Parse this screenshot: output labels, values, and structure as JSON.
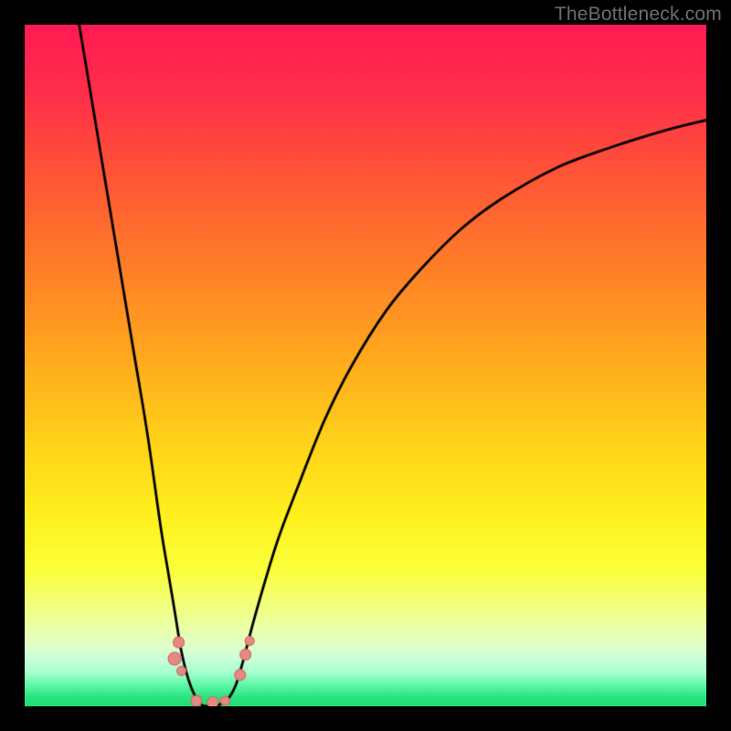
{
  "watermark": "TheBottleneck.com",
  "chart_data": {
    "type": "line",
    "title": "",
    "xlabel": "",
    "ylabel": "",
    "xlim": [
      0,
      100
    ],
    "ylim": [
      0,
      100
    ],
    "grid": false,
    "series": [
      {
        "name": "curve",
        "color": "#000000",
        "x": [
          8,
          10,
          12,
          14,
          16,
          18,
          20,
          21,
          22,
          23,
          24,
          25,
          26,
          27,
          28,
          29,
          30,
          31,
          32,
          34,
          37,
          40,
          44,
          48,
          53,
          58,
          64,
          70,
          78,
          86,
          94,
          100
        ],
        "y": [
          100,
          88,
          76,
          64,
          52,
          40,
          26,
          20,
          14,
          8,
          4,
          1.5,
          0.2,
          0,
          0,
          0.5,
          1.3,
          3.2,
          6.5,
          14,
          24,
          32,
          42,
          50,
          58,
          64,
          70,
          74.5,
          79,
          82,
          84.5,
          86
        ]
      }
    ],
    "markers": [
      {
        "name": "blob-a",
        "x": 22.0,
        "y": 7.0,
        "r": 7
      },
      {
        "name": "blob-b",
        "x": 22.6,
        "y": 9.4,
        "r": 6
      },
      {
        "name": "blob-c",
        "x": 23.0,
        "y": 5.2,
        "r": 5
      },
      {
        "name": "blob-d",
        "x": 25.2,
        "y": 0.8,
        "r": 6
      },
      {
        "name": "blob-e",
        "x": 27.6,
        "y": 0.6,
        "r": 6
      },
      {
        "name": "blob-f",
        "x": 29.4,
        "y": 0.8,
        "r": 5
      },
      {
        "name": "blob-g",
        "x": 31.6,
        "y": 4.6,
        "r": 6
      },
      {
        "name": "blob-h",
        "x": 32.4,
        "y": 7.6,
        "r": 6
      },
      {
        "name": "blob-i",
        "x": 33.0,
        "y": 9.6,
        "r": 5
      }
    ],
    "marker_style": {
      "fill": "#e58a82",
      "stroke": "#d46a60"
    }
  }
}
